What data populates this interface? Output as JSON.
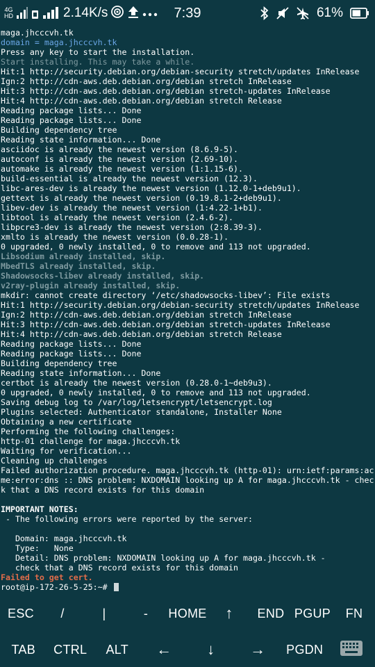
{
  "status_bar": {
    "network_type_top": "4G",
    "network_type_bottom": "HD",
    "speed": "2.14K/s",
    "time": "7:39",
    "battery_percent": "61%",
    "icons": [
      "signal-icon",
      "hd-icon",
      "signal-icon",
      "hotspot-icon",
      "upload-icon",
      "more-icon",
      "bluetooth-icon",
      "mute-icon",
      "airplane-off-icon",
      "battery-icon"
    ]
  },
  "terminal": {
    "lines": [
      {
        "text": "maga.jhcccvh.tk",
        "style": ""
      },
      {
        "text": "domain = maga.jhcccvh.tk",
        "style": "blue"
      },
      {
        "text": "Press any key to start the installation.",
        "style": ""
      },
      {
        "text": "Start installing. This may take a while.",
        "style": "gray"
      },
      {
        "text": "Hit:1 http://security.debian.org/debian-security stretch/updates InRelease",
        "style": ""
      },
      {
        "text": "Ign:2 http://cdn-aws.deb.debian.org/debian stretch InRelease",
        "style": ""
      },
      {
        "text": "Hit:3 http://cdn-aws.deb.debian.org/debian stretch-updates InRelease",
        "style": ""
      },
      {
        "text": "Hit:4 http://cdn-aws.deb.debian.org/debian stretch Release",
        "style": ""
      },
      {
        "text": "Reading package lists... Done",
        "style": ""
      },
      {
        "text": "Reading package lists... Done",
        "style": ""
      },
      {
        "text": "Building dependency tree",
        "style": ""
      },
      {
        "text": "Reading state information... Done",
        "style": ""
      },
      {
        "text": "asciidoc is already the newest version (8.6.9-5).",
        "style": ""
      },
      {
        "text": "autoconf is already the newest version (2.69-10).",
        "style": ""
      },
      {
        "text": "automake is already the newest version (1:1.15-6).",
        "style": ""
      },
      {
        "text": "build-essential is already the newest version (12.3).",
        "style": ""
      },
      {
        "text": "libc-ares-dev is already the newest version (1.12.0-1+deb9u1).",
        "style": ""
      },
      {
        "text": "gettext is already the newest version (0.19.8.1-2+deb9u1).",
        "style": ""
      },
      {
        "text": "libev-dev is already the newest version (1:4.22-1+b1).",
        "style": ""
      },
      {
        "text": "libtool is already the newest version (2.4.6-2).",
        "style": ""
      },
      {
        "text": "libpcre3-dev is already the newest version (2:8.39-3).",
        "style": ""
      },
      {
        "text": "xmlto is already the newest version (0.0.28-1).",
        "style": ""
      },
      {
        "text": "0 upgraded, 0 newly installed, 0 to remove and 113 not upgraded.",
        "style": ""
      },
      {
        "text": "Libsodium already installed, skip.",
        "style": "gray bold"
      },
      {
        "text": "MbedTLS already installed, skip.",
        "style": "gray bold"
      },
      {
        "text": "Shadowsocks-libev already installed, skip.",
        "style": "gray bold"
      },
      {
        "text": "v2ray-plugin already installed, skip.",
        "style": "gray bold"
      },
      {
        "text": "mkdir: cannot create directory ‘/etc/shadowsocks-libev’: File exists",
        "style": ""
      },
      {
        "text": "Hit:1 http://security.debian.org/debian-security stretch/updates InRelease",
        "style": ""
      },
      {
        "text": "Ign:2 http://cdn-aws.deb.debian.org/debian stretch InRelease",
        "style": ""
      },
      {
        "text": "Hit:3 http://cdn-aws.deb.debian.org/debian stretch-updates InRelease",
        "style": ""
      },
      {
        "text": "Hit:4 http://cdn-aws.deb.debian.org/debian stretch Release",
        "style": ""
      },
      {
        "text": "Reading package lists... Done",
        "style": ""
      },
      {
        "text": "Reading package lists... Done",
        "style": ""
      },
      {
        "text": "Building dependency tree",
        "style": ""
      },
      {
        "text": "Reading state information... Done",
        "style": ""
      },
      {
        "text": "certbot is already the newest version (0.28.0-1~deb9u3).",
        "style": ""
      },
      {
        "text": "0 upgraded, 0 newly installed, 0 to remove and 113 not upgraded.",
        "style": ""
      },
      {
        "text": "Saving debug log to /var/log/letsencrypt/letsencrypt.log",
        "style": ""
      },
      {
        "text": "Plugins selected: Authenticator standalone, Installer None",
        "style": ""
      },
      {
        "text": "Obtaining a new certificate",
        "style": ""
      },
      {
        "text": "Performing the following challenges:",
        "style": ""
      },
      {
        "text": "http-01 challenge for maga.jhcccvh.tk",
        "style": ""
      },
      {
        "text": "Waiting for verification...",
        "style": ""
      },
      {
        "text": "Cleaning up challenges",
        "style": ""
      },
      {
        "text": "Failed authorization procedure. maga.jhcccvh.tk (http-01): urn:ietf:params:ac",
        "style": ""
      },
      {
        "text": "me:error:dns :: DNS problem: NXDOMAIN looking up A for maga.jhcccvh.tk - chec",
        "style": ""
      },
      {
        "text": "k that a DNS record exists for this domain",
        "style": ""
      },
      {
        "text": "",
        "style": ""
      },
      {
        "text": "IMPORTANT NOTES:",
        "style": "bold"
      },
      {
        "text": " - The following errors were reported by the server:",
        "style": ""
      },
      {
        "text": "",
        "style": ""
      },
      {
        "text": "   Domain: maga.jhcccvh.tk",
        "style": ""
      },
      {
        "text": "   Type:   None",
        "style": ""
      },
      {
        "text": "   Detail: DNS problem: NXDOMAIN looking up A for maga.jhcccvh.tk -",
        "style": ""
      },
      {
        "text": "   check that a DNS record exists for this domain",
        "style": ""
      },
      {
        "text": "Failed to get cert.",
        "style": "red bold"
      }
    ],
    "prompt": "root@ip-172-26-5-25:~# "
  },
  "extra_keys": {
    "row1": [
      {
        "label": "ESC",
        "name": "key-esc"
      },
      {
        "label": "/",
        "name": "key-slash"
      },
      {
        "label": "|",
        "name": "key-pipe"
      },
      {
        "label": "-",
        "name": "key-minus"
      },
      {
        "label": "HOME",
        "name": "key-home"
      },
      {
        "label": "↑",
        "name": "key-up-arrow"
      },
      {
        "label": "END",
        "name": "key-end"
      },
      {
        "label": "PGUP",
        "name": "key-pgup"
      },
      {
        "label": "FN",
        "name": "key-fn"
      }
    ],
    "row2": [
      {
        "label": "TAB",
        "name": "key-tab"
      },
      {
        "label": "CTRL",
        "name": "key-ctrl"
      },
      {
        "label": "ALT",
        "name": "key-alt"
      },
      {
        "label": "←",
        "name": "key-left-arrow"
      },
      {
        "label": "↓",
        "name": "key-down-arrow"
      },
      {
        "label": "→",
        "name": "key-right-arrow"
      },
      {
        "label": "PGDN",
        "name": "key-pgdn"
      },
      {
        "label": "",
        "name": "keyboard-toggle-button",
        "icon": "keyboard-icon"
      }
    ]
  }
}
